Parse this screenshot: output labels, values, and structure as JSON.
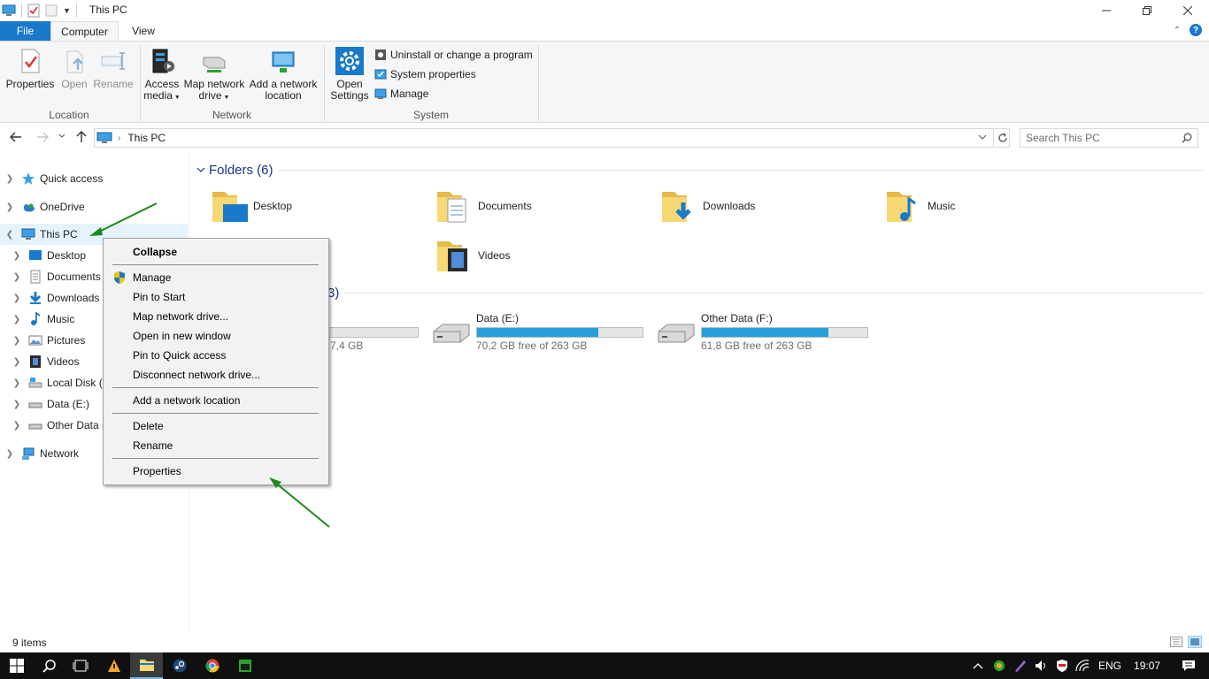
{
  "window": {
    "title": "This PC"
  },
  "tabs": {
    "file": "File",
    "computer": "Computer",
    "view": "View"
  },
  "ribbon": {
    "location": {
      "label": "Location",
      "properties": "Properties",
      "open": "Open",
      "rename": "Rename"
    },
    "network": {
      "label": "Network",
      "access_media_1": "Access",
      "access_media_2": "media",
      "map_drive_1": "Map network",
      "map_drive_2": "drive",
      "add_location_1": "Add a network",
      "add_location_2": "location"
    },
    "system": {
      "label": "System",
      "open_settings_1": "Open",
      "open_settings_2": "Settings",
      "uninstall": "Uninstall or change a program",
      "system_properties": "System properties",
      "manage": "Manage"
    }
  },
  "address": {
    "path": "This PC",
    "search_placeholder": "Search This PC"
  },
  "navpane": {
    "items": [
      {
        "label": "Quick access"
      },
      {
        "label": "OneDrive"
      },
      {
        "label": "This PC"
      },
      {
        "label": "Desktop"
      },
      {
        "label": "Documents"
      },
      {
        "label": "Downloads"
      },
      {
        "label": "Music"
      },
      {
        "label": "Pictures"
      },
      {
        "label": "Videos"
      },
      {
        "label": "Local Disk ("
      },
      {
        "label": "Data (E:)"
      },
      {
        "label": "Other Data ("
      },
      {
        "label": "Network"
      }
    ]
  },
  "content": {
    "folders_header": "Folders (6)",
    "devices_header_partial": "3)",
    "folders": [
      {
        "name": "Desktop"
      },
      {
        "name": "Documents"
      },
      {
        "name": "Downloads"
      },
      {
        "name": "Music"
      },
      {
        "name": "Videos"
      }
    ],
    "drives": [
      {
        "name": "",
        "free": "7,4 GB",
        "used_fraction": 0.0
      },
      {
        "name": "Data (E:)",
        "free": "70,2 GB free of 263 GB",
        "used_fraction": 0.733
      },
      {
        "name": "Other Data (F:)",
        "free": "61,8 GB free of 263 GB",
        "used_fraction": 0.765
      }
    ]
  },
  "context_menu": {
    "collapse": "Collapse",
    "manage": "Manage",
    "pin_start": "Pin to Start",
    "map_drive": "Map network drive...",
    "open_new": "Open in new window",
    "pin_quick": "Pin to Quick access",
    "disconnect": "Disconnect network drive...",
    "add_location": "Add a network location",
    "delete": "Delete",
    "rename": "Rename",
    "properties": "Properties"
  },
  "status": {
    "items": "9 items"
  },
  "taskbar": {
    "lang": "ENG",
    "time": "19:07"
  },
  "colors": {
    "accent": "#1979ca",
    "drive_fill": "#26a0da",
    "selected": "#e5f3ff",
    "arrow": "#1a8a1a"
  }
}
